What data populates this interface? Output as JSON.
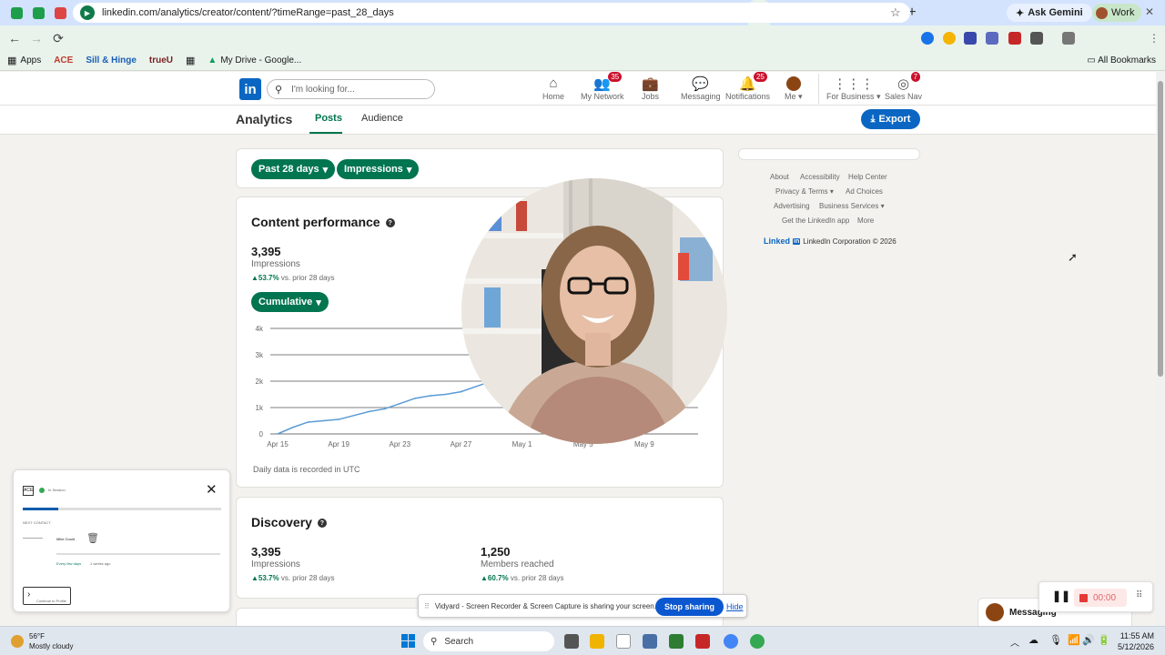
{
  "browser": {
    "url": "linkedin.com/analytics/creator/content/?timeRange=past_28_days",
    "ask_gemini": "Ask Gemini",
    "profile_label": "Work",
    "bookmarks": [
      "Apps",
      "ACE",
      "Sill & Hinge",
      "trueU",
      "My Drive - Google..."
    ],
    "all_bookmarks": "All Bookmarks"
  },
  "header": {
    "search_placeholder": "I'm looking for...",
    "nav": [
      {
        "label": "Home",
        "badge": ""
      },
      {
        "label": "My Network",
        "badge": "35"
      },
      {
        "label": "Jobs",
        "badge": ""
      },
      {
        "label": "Messaging",
        "badge": ""
      },
      {
        "label": "Notifications",
        "badge": "25"
      },
      {
        "label": "Me",
        "badge": ""
      },
      {
        "label": "For Business",
        "badge": ""
      },
      {
        "label": "Sales Nav",
        "badge": "7"
      }
    ]
  },
  "subnav": {
    "title": "Analytics",
    "tabs": [
      "Posts",
      "Audience"
    ],
    "active_tab": "Posts",
    "export_label": "Export"
  },
  "filters": {
    "time_range": "Past 28 days",
    "metric": "Impressions"
  },
  "content_performance": {
    "title": "Content performance",
    "impressions": "3,395",
    "impressions_label": "Impressions",
    "delta_value": "53.7%",
    "delta_text": "vs. prior 28 days",
    "mode": "Cumulative",
    "footnote": "Daily data is recorded in UTC"
  },
  "chart_data": {
    "type": "line",
    "x": [
      "Apr 15",
      "Apr 16",
      "Apr 17",
      "Apr 18",
      "Apr 19",
      "Apr 20",
      "Apr 21",
      "Apr 22",
      "Apr 23",
      "Apr 24",
      "Apr 25",
      "Apr 26",
      "Apr 27",
      "Apr 28",
      "Apr 29"
    ],
    "x_ticks": [
      "Apr 15",
      "Apr 19",
      "Apr 23",
      "Apr 27",
      "May 1",
      "May 5",
      "May 9"
    ],
    "y_ticks": [
      "0",
      "1k",
      "2k",
      "3k",
      "4k"
    ],
    "ylim": [
      0,
      4000
    ],
    "series": [
      {
        "values": [
          0,
          250,
          450,
          500,
          550,
          700,
          850,
          950,
          1150,
          1350,
          1450,
          1500,
          1600,
          1800,
          2000
        ]
      }
    ],
    "grid": true,
    "xlabel": "",
    "ylabel": "",
    "title": "Content performance"
  },
  "discovery": {
    "title": "Discovery",
    "impressions": "3,395",
    "impressions_label": "Impressions",
    "impressions_delta": "53.7%",
    "members": "1,250",
    "members_label": "Members reached",
    "members_delta": "60.7%",
    "delta_text": "vs. prior 28 days"
  },
  "footer": {
    "links_row1": [
      "About",
      "Accessibility",
      "Help Center"
    ],
    "links_row2": [
      "Privacy & Terms",
      "Ad Choices"
    ],
    "links_row3": [
      "Advertising",
      "Business Services"
    ],
    "links_row4": [
      "Get the LinkedIn app",
      "More"
    ],
    "brand": "Linked",
    "corp": "LinkedIn Corporation © 2026"
  },
  "overlay": {
    "status": "In Session",
    "next_contact": "NEXT CONTACT",
    "contact_name": "Mike Gould",
    "meta1": "Every few days",
    "meta2": "1 weeks ago",
    "continue": "Continue to Profile"
  },
  "sharebar": {
    "message": "Vidyard - Screen Recorder & Screen Capture is sharing your screen.",
    "stop": "Stop sharing",
    "hide": "Hide"
  },
  "messaging": {
    "label": "Messaging"
  },
  "recorder": {
    "time": "00:00"
  },
  "taskbar": {
    "temp": "56°F",
    "weather": "Mostly cloudy",
    "search": "Search",
    "time": "11:55 AM",
    "date": "5/12/2026"
  },
  "colors": {
    "linkedin_blue": "#0a66c2",
    "linkedin_green": "#01754f"
  }
}
